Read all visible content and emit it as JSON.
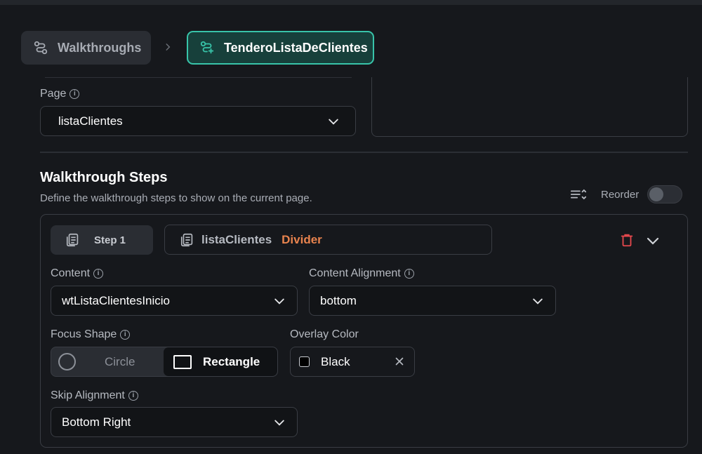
{
  "breadcrumb": {
    "parent_label": "Walkthroughs",
    "current_label": "TenderoListaDeClientes"
  },
  "page_field": {
    "label": "Page",
    "value": "listaClientes"
  },
  "steps_section": {
    "title": "Walkthrough Steps",
    "description": "Define the walkthrough steps to show on the current page.",
    "reorder_label": "Reorder",
    "reorder_enabled": false
  },
  "step": {
    "badge_label": "Step 1",
    "page_name": "listaClientes",
    "widget_name": "Divider",
    "content": {
      "label": "Content",
      "value": "wtListaClientesInicio"
    },
    "content_alignment": {
      "label": "Content Alignment",
      "value": "bottom"
    },
    "focus_shape": {
      "label": "Focus Shape",
      "options": [
        "Circle",
        "Rectangle"
      ],
      "selected": "Rectangle"
    },
    "overlay_color": {
      "label": "Overlay Color",
      "value": "Black",
      "swatch": "#000000"
    },
    "skip_alignment": {
      "label": "Skip Alignment",
      "value": "Bottom Right"
    }
  },
  "colors": {
    "accent": "#38c4a9",
    "widget_highlight": "#e8834e",
    "danger": "#e5484d",
    "background": "#16181c"
  }
}
